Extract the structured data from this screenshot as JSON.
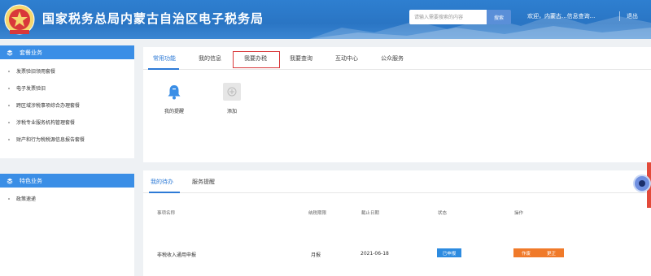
{
  "header": {
    "site_title": "国家税务总局内蒙古自治区电子税务局",
    "search_placeholder": "请输入需要搜索的内容",
    "search_button": "搜索",
    "welcome": "欢迎，内蒙古...信息查询...",
    "logout": "退出"
  },
  "sidebar": {
    "section1": {
      "title": "套餐业务",
      "items": [
        "发票验旧领用套餐",
        "电子发票验旧",
        "跨区域涉税事项综合办理套餐",
        "涉税专业服务机构管理套餐",
        "财产和行为税税源信息报告套餐"
      ]
    },
    "section2": {
      "title": "特色业务",
      "items": [
        "政策速递"
      ]
    }
  },
  "main": {
    "tabs": [
      "常用功能",
      "我的信息",
      "我要办税",
      "我要查询",
      "互动中心",
      "公众服务"
    ],
    "functions": [
      {
        "label": "我的提醒",
        "icon": "bell-icon"
      },
      {
        "label": "添加",
        "icon": "plus-icon"
      }
    ]
  },
  "todo": {
    "tabs": [
      "我的待办",
      "服务提醒"
    ],
    "columns": [
      "事项名称",
      "纳税期限",
      "截止日期",
      "状态",
      "操作"
    ],
    "rows": [
      {
        "name": "非税收入通用申报",
        "period": "月报",
        "deadline": "2021-06-18",
        "status": "已申报",
        "actions": [
          "作废",
          "更正"
        ]
      }
    ]
  },
  "colors": {
    "header_blue": "#2a75c4",
    "sidebar_head": "#3a8ee6",
    "accent_blue": "#2d7ad6",
    "highlight_red": "#d9383a",
    "action_orange": "#f07a2a"
  }
}
